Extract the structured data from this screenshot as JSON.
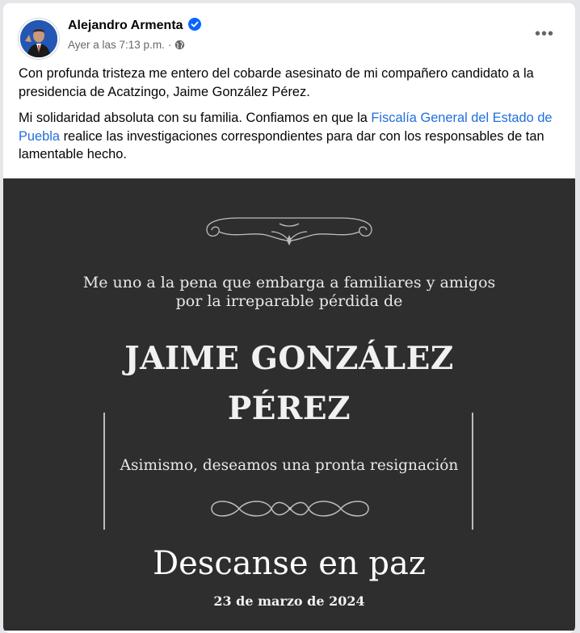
{
  "post": {
    "author": "Alejandro Armenta",
    "timestamp": "Ayer a las 7:13 p.m.",
    "separator": "·",
    "more_label": "•••",
    "paragraph1": "Con profunda tristeza me entero del cobarde asesinato de mi compañero candidato a la presidencia de Acatzingo, Jaime González Pérez.",
    "paragraph2_start": "Mi solidaridad absoluta con su familia. Confiamos en que la ",
    "paragraph2_link": "Fiscalía General del Estado de Puebla",
    "paragraph2_end": " realice las investigaciones correspondientes para dar con los responsables de tan lamentable hecho."
  },
  "image": {
    "line1": "Me uno a la pena que embarga a familiares y amigos",
    "line2": "por la irreparable pérdida de",
    "name_line1": "JAIME GONZÁLEZ",
    "name_line2": "PÉREZ",
    "resignation": "Asimismo, deseamos una pronta resignación",
    "rest_in_peace": "Descanse en paz",
    "date": "23 de marzo de 2024"
  },
  "colors": {
    "link": "#216fdb",
    "verified": "#0866ff",
    "image_background": "#2e2e2e"
  },
  "icons": [
    "verified-badge-icon",
    "globe-icon",
    "more-options-icon"
  ]
}
